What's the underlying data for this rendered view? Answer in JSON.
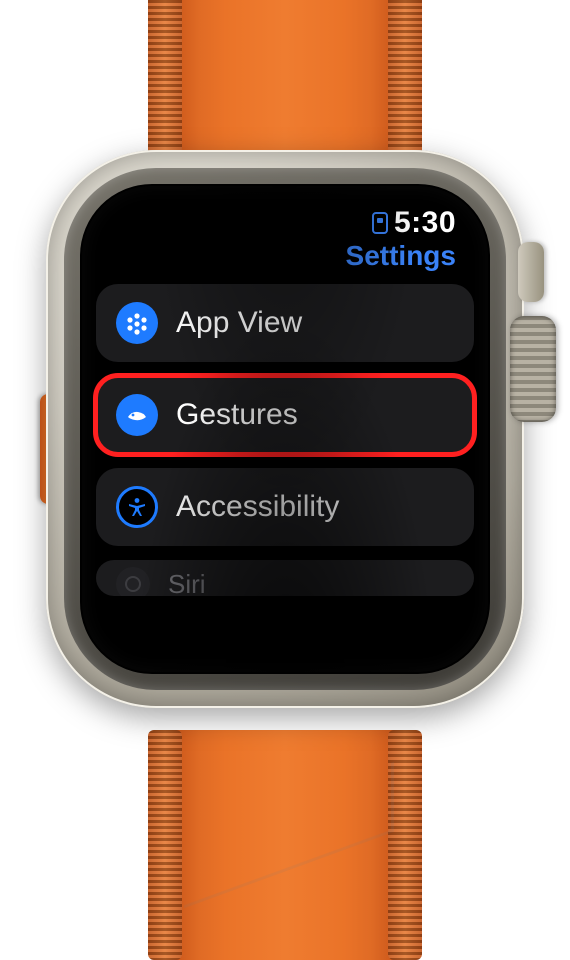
{
  "status": {
    "time": "5:30"
  },
  "header": {
    "title": "Settings"
  },
  "rows": {
    "appview": {
      "label": "App View"
    },
    "gestures": {
      "label": "Gestures"
    },
    "accessibility": {
      "label": "Accessibility"
    },
    "siri": {
      "label": "Siri"
    }
  },
  "highlight": "gestures",
  "colors": {
    "accent": "#3a82f7",
    "rowBg": "#1c1c1e",
    "band": "#ea7328",
    "highlightRing": "#ff2020"
  }
}
